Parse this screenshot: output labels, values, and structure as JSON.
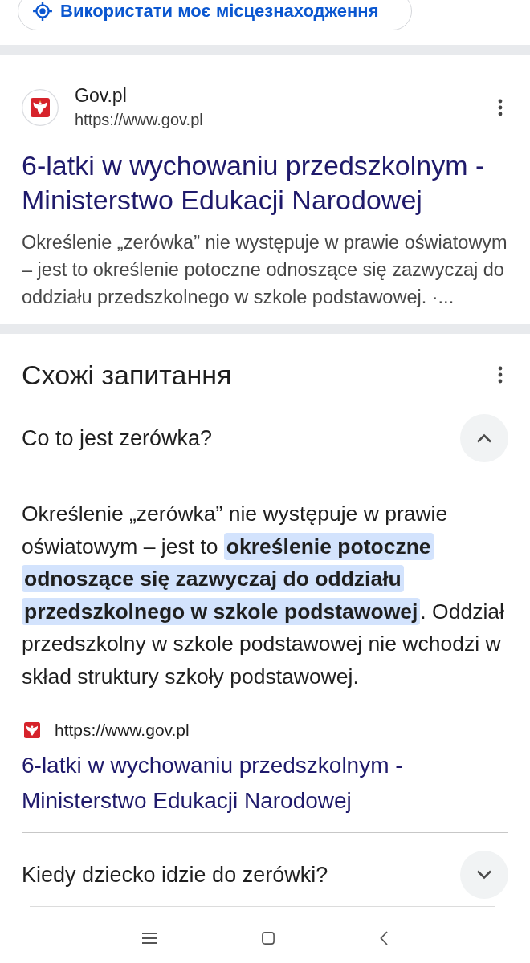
{
  "location_button": {
    "label": "Використати моє місцезнаходження"
  },
  "result": {
    "site_name": "Gov.pl",
    "url": "https://www.gov.pl",
    "title": "6-latki w wychowaniu przedszkolnym - Ministerstwo Edukacji Narodowej",
    "snippet": "Określenie „zerówka” nie występuje w prawie oświatowym – jest to określenie potoczne odnoszące się zazwyczaj do oddziału przedszkolnego w szkole podstawowej. ·..."
  },
  "related_questions": {
    "heading": "Схожі запитання",
    "items": [
      {
        "question": "Co to jest zerówka?",
        "expanded": true,
        "answer": "Określenie „zerówka” nie występuje w prawie oświatowym – jest to **określenie potoczne odnoszące się zazwyczaj do oddziału przedszkolnego w szkole podstawowej**. Oddział przedszkolny w szkole podstawowej nie wchodzi w skład struktury szkoły podstawowej.",
        "source_url": "https://www.gov.pl",
        "source_title": "6-latki w wychowaniu przedszkolnym - Ministerstwo Edukacji Narodowej"
      },
      {
        "question": "Kiedy dziecko idzie do zerówki?",
        "expanded": false
      }
    ]
  }
}
